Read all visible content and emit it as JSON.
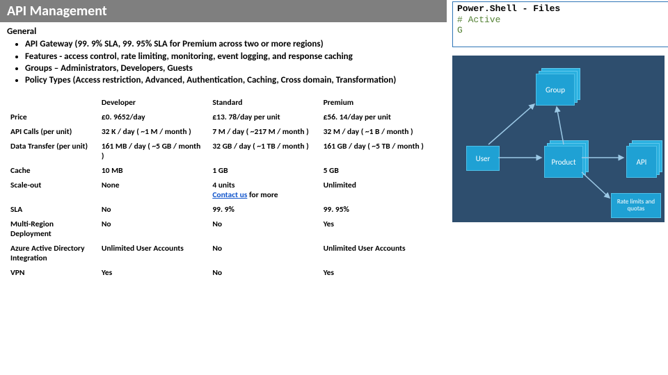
{
  "title": "API Management",
  "code_box": {
    "title": "Power.Shell - Files",
    "line1": "# Active",
    "line2": "G"
  },
  "general": {
    "heading": "General",
    "bullets": [
      "API Gateway (99. 9% SLA, 99. 95% SLA for Premium across two or more regions)",
      "Features - access control, rate limiting, monitoring, event logging, and response caching",
      "Groups – Administrators, Developers, Guests",
      "Policy Types (Access restriction, Advanced, Authentication, Caching, Cross domain, Transformation)"
    ]
  },
  "tiers": {
    "cols": [
      "Developer",
      "Standard",
      "Premium"
    ],
    "rows": [
      {
        "label": "Price",
        "c": [
          "£0. 9652/day",
          "£13. 78/day per unit",
          "£56. 14/day per unit"
        ]
      },
      {
        "label": "API Calls (per unit)",
        "c": [
          "32 K / day ( ~1 M / month )",
          "7 M / day ( ~217 M / month )",
          "32 M / day ( ~1 B / month )"
        ]
      },
      {
        "label": "Data Transfer (per unit)",
        "c": [
          "161 MB / day ( ~5 GB / month )",
          "32 GB / day ( ~1 TB / month )",
          "161 GB / day ( ~5 TB / month )"
        ]
      },
      {
        "label": "Cache",
        "c": [
          "10 MB",
          "1 GB",
          "5 GB"
        ]
      },
      {
        "label": "Scale-out",
        "c": [
          "None",
          "4 units\nContact us for more",
          "Unlimited"
        ],
        "link_row": true
      },
      {
        "label": "SLA",
        "c": [
          "No",
          "99. 9%",
          "99. 95%"
        ]
      },
      {
        "label": "Multi-Region Deployment",
        "c": [
          "No",
          "No",
          "Yes"
        ]
      },
      {
        "label": "Azure Active Directory Integration",
        "c": [
          "Unlimited User Accounts",
          "No",
          "Unlimited User Accounts"
        ]
      },
      {
        "label": "VPN",
        "c": [
          "Yes",
          "No",
          "Yes"
        ]
      }
    ],
    "contact_text": "Contact us"
  },
  "diagram": {
    "boxes": {
      "group": "Group",
      "user": "User",
      "product": "Product",
      "api": "API",
      "quota": "Rate limits and quotas"
    }
  }
}
